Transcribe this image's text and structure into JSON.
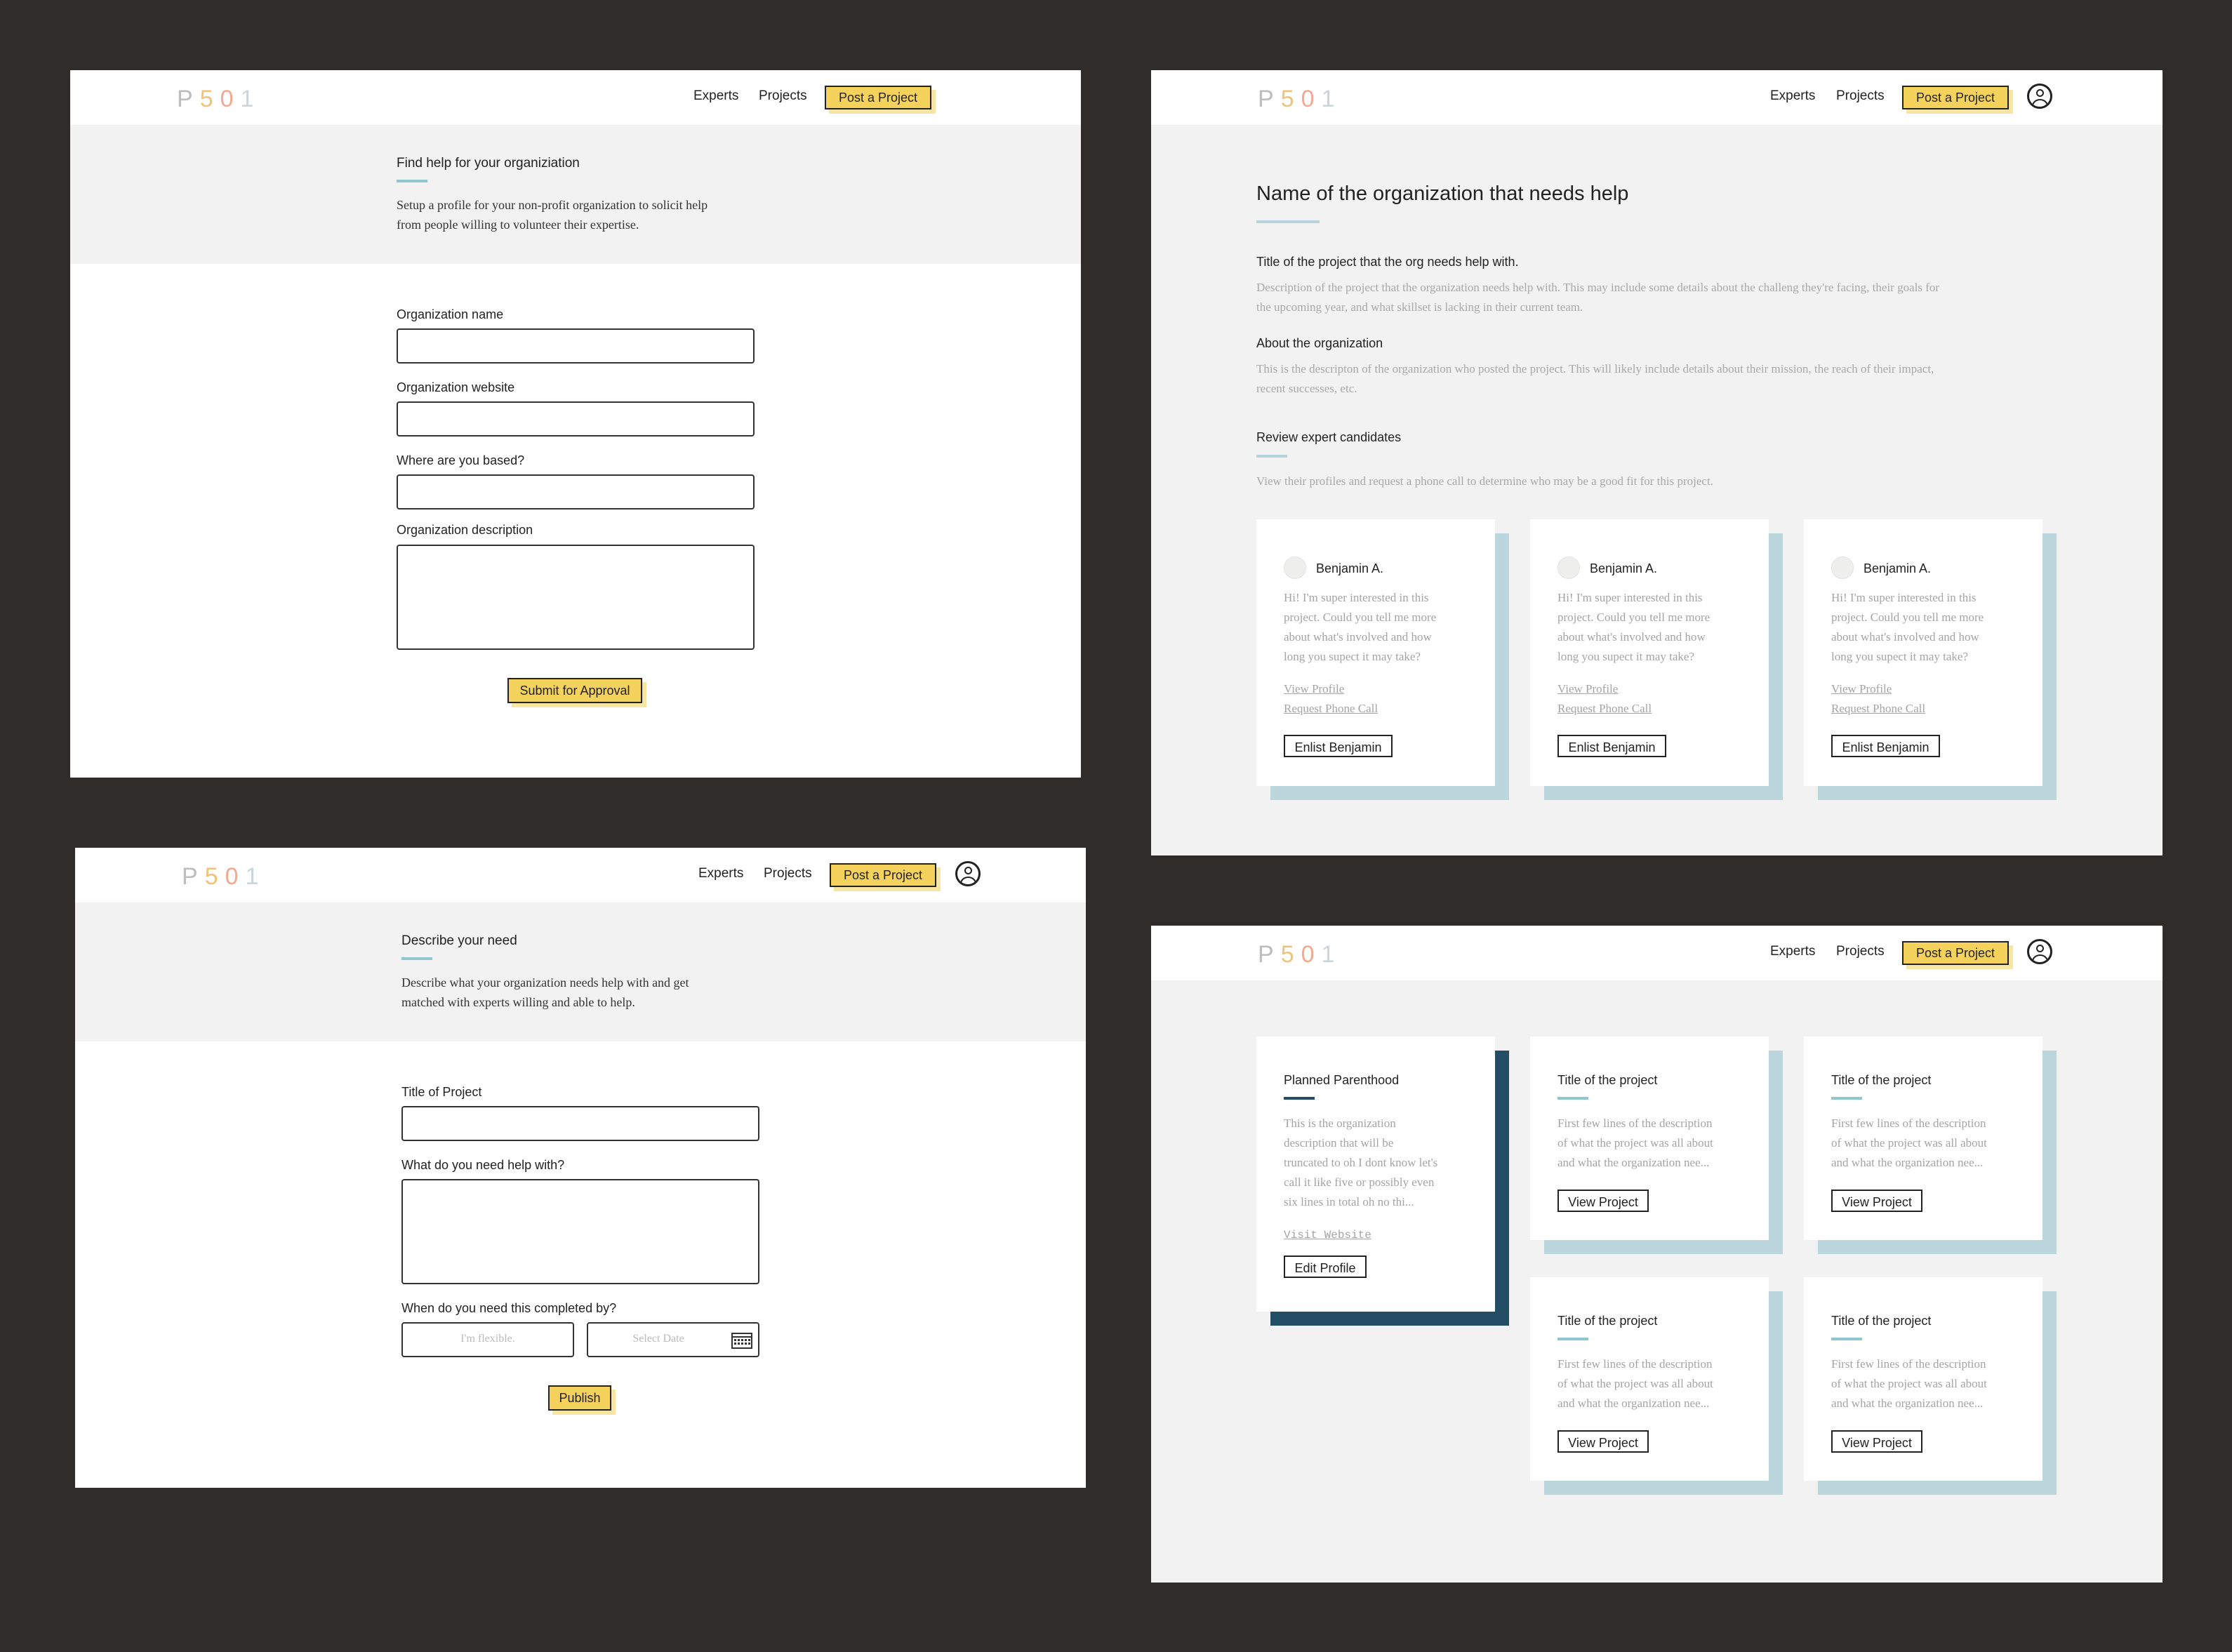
{
  "nav": {
    "logo": "P501",
    "experts": "Experts",
    "projects": "Projects",
    "post_project": "Post a Project"
  },
  "org_signup": {
    "title": "Find help for your organiziation",
    "intro_line1": "Setup a profile for your non-profit organization to solicit help",
    "intro_line2": "from people willing to volunteer their expertise.",
    "org_name_label": "Organization name",
    "org_website_label": "Organization website",
    "based_label": "Where are you based?",
    "description_label": "Organization description",
    "submit": "Submit for Approval"
  },
  "project_detail": {
    "org_name": "Name of the organization that needs help",
    "project_title": "Title of the project that the org needs help with.",
    "project_desc_line1": "Description of the project that the organization needs help with. This may include some details about the challeng they're facing, their goals for",
    "project_desc_line2": "the upcoming year, and what skillset is lacking in their current team.",
    "about_title": "About the organization",
    "about_line1": "This is the descripton of the organization who posted the project. This will likely include details about their mission, the reach of their impact,",
    "about_line2": "recent successes, etc.",
    "review_title": "Review expert candidates",
    "review_text": "View their profiles and request a phone call to determine who may be a good fit for this project.",
    "candidates": [
      {
        "name": "Benjamin A.",
        "msg1": "Hi! I'm super interested in this",
        "msg2": "project. Could you tell me more",
        "msg3": "about what's involved and how",
        "msg4": "long you supect it may take?",
        "view_profile": "View Profile",
        "request_call": "Request Phone Call",
        "enlist": "Enlist Benjamin"
      },
      {
        "name": "Benjamin A.",
        "msg1": "Hi! I'm super interested in this",
        "msg2": "project. Could you tell me more",
        "msg3": "about what's involved and how",
        "msg4": "long you supect it may take?",
        "view_profile": "View Profile",
        "request_call": "Request Phone Call",
        "enlist": "Enlist Benjamin"
      },
      {
        "name": "Benjamin A.",
        "msg1": "Hi! I'm super interested in this",
        "msg2": "project. Could you tell me more",
        "msg3": "about what's involved and how",
        "msg4": "long you supect it may take?",
        "view_profile": "View Profile",
        "request_call": "Request Phone Call",
        "enlist": "Enlist Benjamin"
      }
    ]
  },
  "describe_need": {
    "title": "Describe your need",
    "intro_line1": "Describe what your organization needs help with and get",
    "intro_line2": "matched with experts willing and able to help.",
    "project_title_label": "Title of Project",
    "help_label": "What do you need help with?",
    "when_label": "When do you need this completed by?",
    "flexible_placeholder": "I'm flexible.",
    "date_placeholder": "Select Date",
    "publish": "Publish"
  },
  "org_profile": {
    "org_card": {
      "name": "Planned Parenthood",
      "desc1": "This is the organization",
      "desc2": "description that will be",
      "desc3": "truncated to oh I dont know let's",
      "desc4": "call it like five or possibly even",
      "desc5": "six lines in total oh no thi...",
      "visit": "Visit Website",
      "edit": "Edit Profile"
    },
    "projects": [
      {
        "title": "Title of the project",
        "d1": "First few lines of the description",
        "d2": "of what the project was all about",
        "d3": "and what the organization nee...",
        "button": "View Project"
      },
      {
        "title": "Title of the project",
        "d1": "First few lines of the description",
        "d2": "of what the project was all about",
        "d3": "and what the organization nee...",
        "button": "View Project"
      },
      {
        "title": "Title of the project",
        "d1": "First few lines of the description",
        "d2": "of what the project was all about",
        "d3": "and what the organization nee...",
        "button": "View Project"
      },
      {
        "title": "Title of the project",
        "d1": "First few lines of the description",
        "d2": "of what the project was all about",
        "d3": "and what the organization nee...",
        "button": "View Project"
      }
    ]
  },
  "colors": {
    "background": "#2f2c2a",
    "accent_yellow": "#f4d25b",
    "accent_teal": "#8fc7cf",
    "card_shadow_blue": "#bcd6dd",
    "dark_blue": "#244e66"
  },
  "icons": [
    "user-avatar-icon",
    "calendar-icon",
    "candidate-avatar"
  ]
}
